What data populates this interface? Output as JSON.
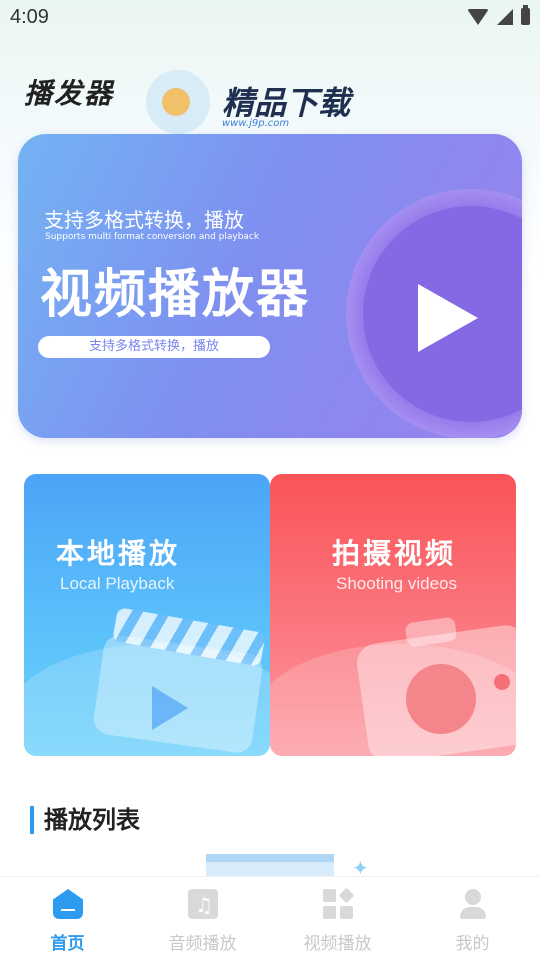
{
  "status_bar": {
    "time": "4:09"
  },
  "header": {
    "app_title": "播发器",
    "watermark_text": "精品下载",
    "watermark_url": "www.j9p.com"
  },
  "banner": {
    "subtitle": "支持多格式转换，播放",
    "subtitle_en": "Supports multi format conversion and playback",
    "title": "视频播放器",
    "pill_text": "支持多格式转换，播放"
  },
  "cards": [
    {
      "title": "本地播放",
      "subtitle": "Local Playback"
    },
    {
      "title": "拍摄视频",
      "subtitle": "Shooting videos"
    }
  ],
  "section": {
    "title": "播放列表"
  },
  "tabbar": {
    "items": [
      {
        "label": "首页",
        "icon": "home-icon",
        "active": true
      },
      {
        "label": "音频播放",
        "icon": "music-file-icon",
        "active": false
      },
      {
        "label": "视频播放",
        "icon": "grid-icon",
        "active": false
      },
      {
        "label": "我的",
        "icon": "user-icon",
        "active": false
      }
    ]
  },
  "colors": {
    "accent": "#2d9cf0",
    "local_card": "#4ca4f8",
    "shoot_card": "#f95457",
    "banner": "#7f8ff0"
  }
}
